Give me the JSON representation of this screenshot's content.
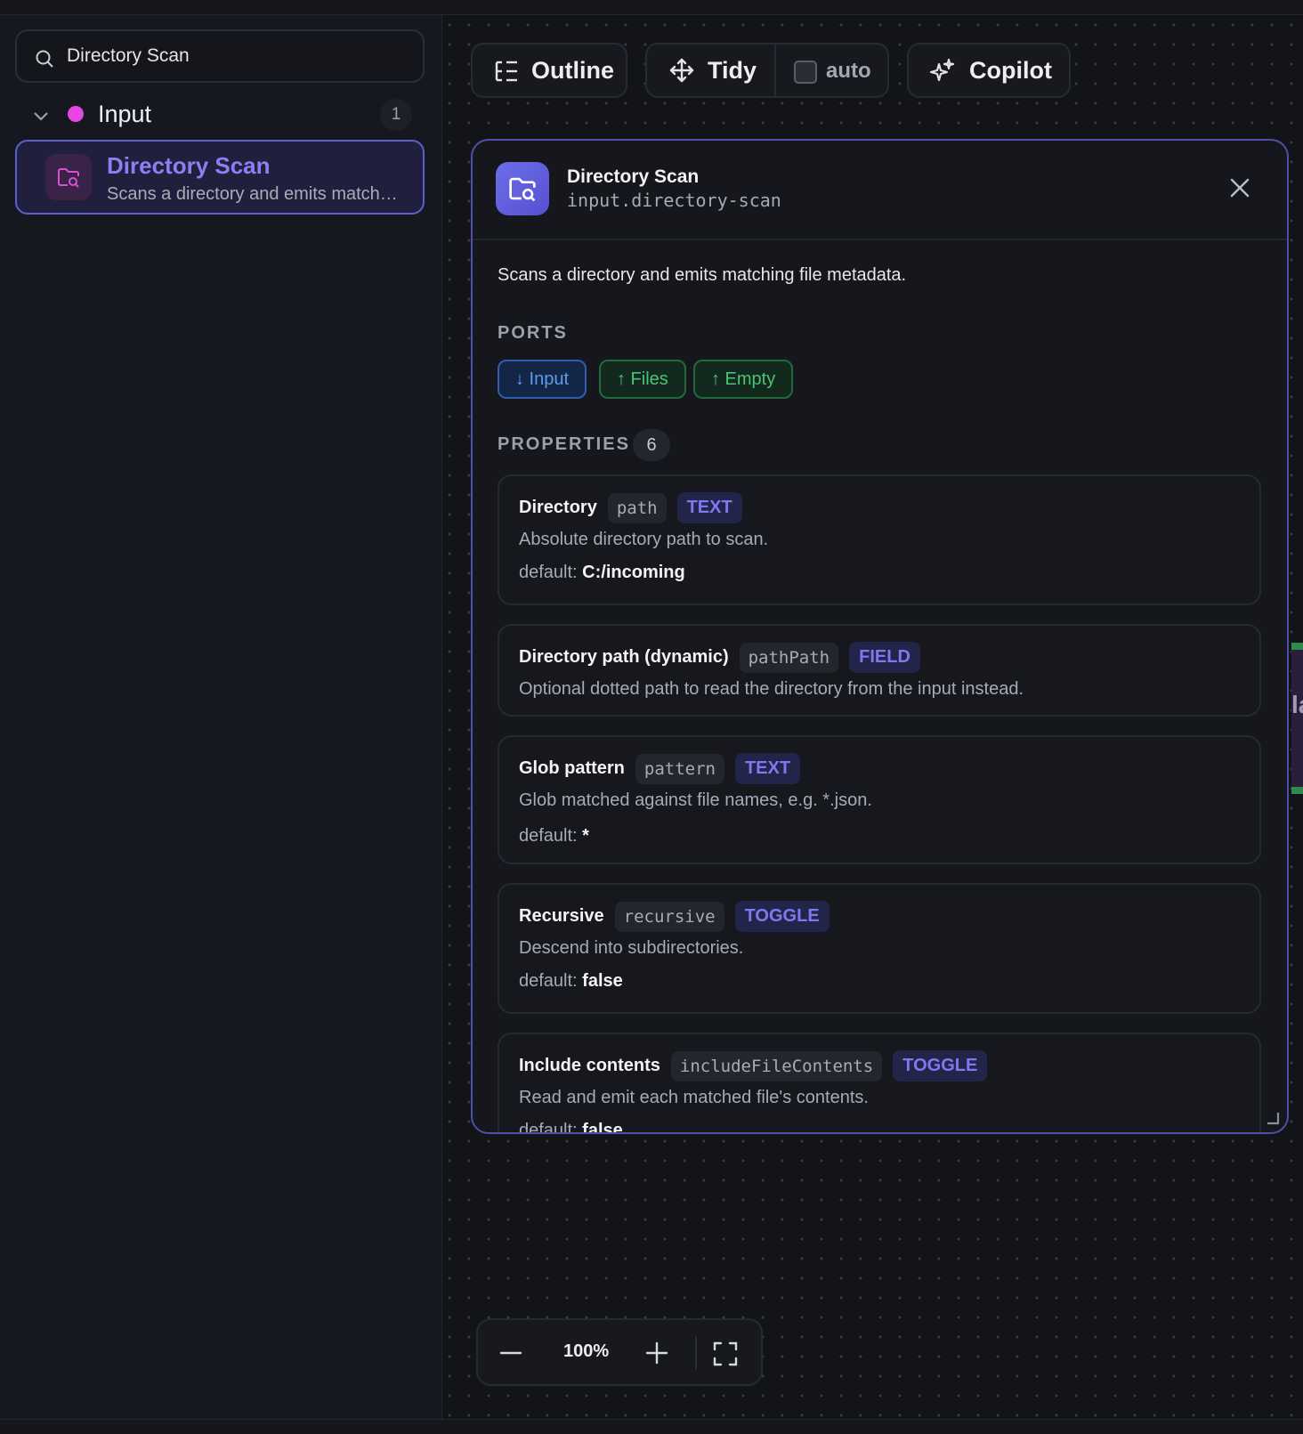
{
  "sidebar": {
    "search_value": "Directory Scan",
    "group": {
      "label": "Input",
      "count": "1",
      "dot_color": "#e647e6"
    },
    "item": {
      "title": "Directory Scan",
      "description": "Scans a directory and emits matching file metadata."
    }
  },
  "toolbar": {
    "outline_label": "Outline",
    "tidy_label": "Tidy",
    "auto_label": "auto",
    "auto_checked": false,
    "copilot_label": "Copilot"
  },
  "panel": {
    "title": "Directory Scan",
    "node_type": "input.directory-scan",
    "description": "Scans a directory and emits matching file metadata.",
    "ports_heading": "PORTS",
    "ports": [
      {
        "label": "↓ Input",
        "direction": "in"
      },
      {
        "label": "↑ Files",
        "direction": "out"
      },
      {
        "label": "↑ Empty",
        "direction": "out"
      }
    ],
    "properties_heading": "PROPERTIES",
    "properties_count": "6",
    "properties": [
      {
        "name": "Directory",
        "key": "path",
        "type": "TEXT",
        "description": "Absolute directory path to scan.",
        "default_label": "default:",
        "default": "C:/incoming"
      },
      {
        "name": "Directory path (dynamic)",
        "key": "pathPath",
        "type": "FIELD",
        "description": "Optional dotted path to read the directory from the input instead."
      },
      {
        "name": "Glob pattern",
        "key": "pattern",
        "type": "TEXT",
        "description": "Glob matched against file names, e.g. *.json.",
        "default_label": "default:",
        "default": "*"
      },
      {
        "name": "Recursive",
        "key": "recursive",
        "type": "TOGGLE",
        "description": "Descend into subdirectories.",
        "default_label": "default:",
        "default": "false"
      },
      {
        "name": "Include contents",
        "key": "includeFileContents",
        "type": "TOGGLE",
        "description": "Read and emit each matched file's contents.",
        "default_label": "default:",
        "default": "false"
      }
    ]
  },
  "canvas": {
    "peek_text": "la"
  },
  "zoom": {
    "level": "100%"
  },
  "colors": {
    "accent": "#6d6ee8",
    "port_in": "#5f9af0",
    "port_out": "#4cc278"
  }
}
